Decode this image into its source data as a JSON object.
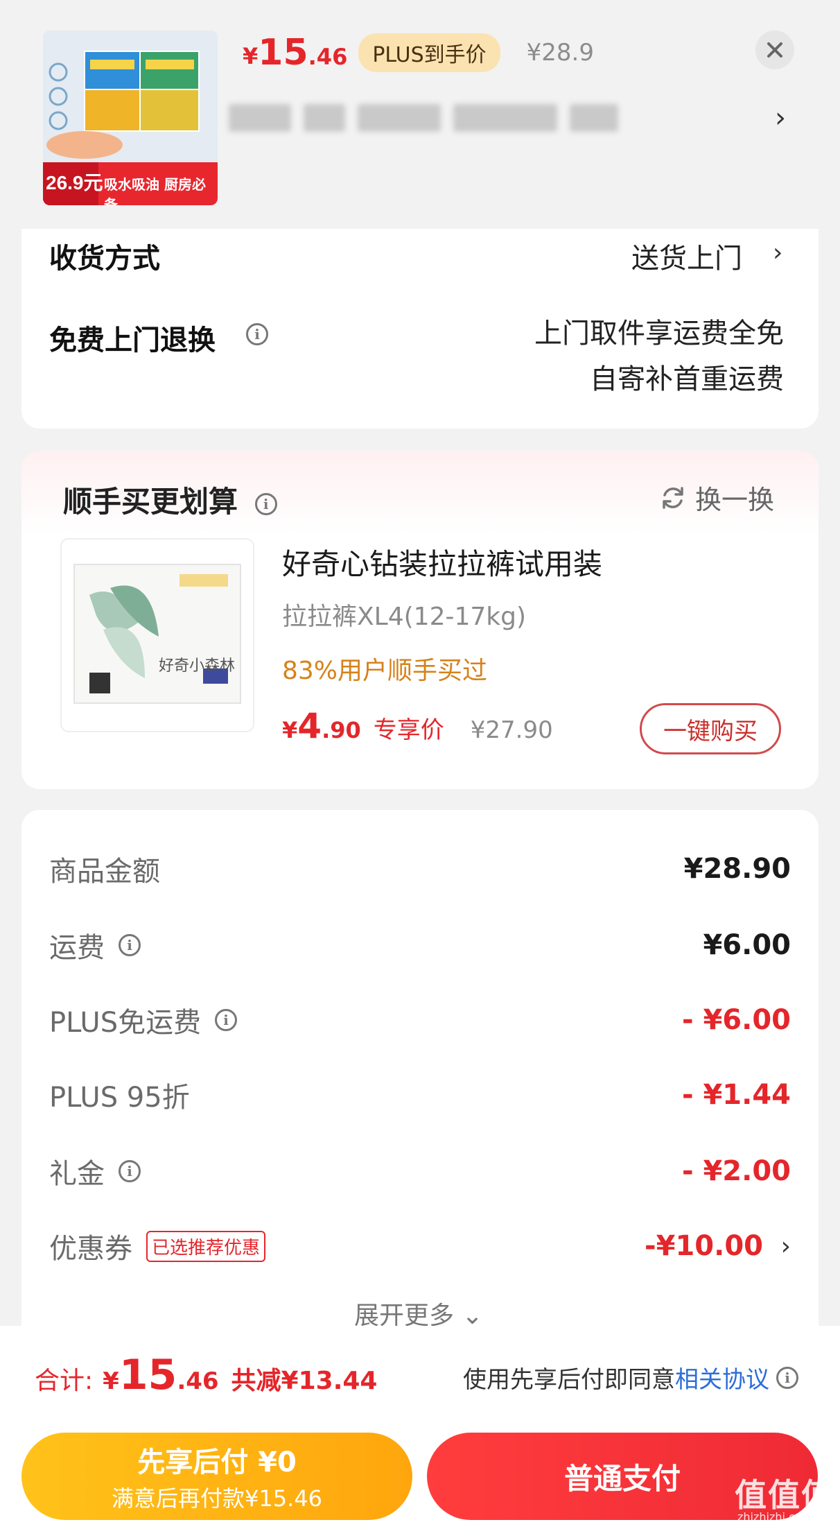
{
  "header": {
    "price_symbol": "¥",
    "price_int": "15",
    "price_dec": ".46",
    "plus_badge": "PLUS到手价",
    "orig_price": "¥28.9",
    "thumb_promo_price": "26.9元",
    "thumb_promo_text": "吸水吸油 厨房必备"
  },
  "shipping": {
    "method_label": "收货方式",
    "method_value": "送货上门",
    "return_label": "免费上门退换",
    "return_line1": "上门取件享运费全免",
    "return_line2": "自寄补首重运费"
  },
  "bundle": {
    "title": "顺手买更划算",
    "swap_label": "换一换",
    "product_name": "好奇心钻装拉拉裤试用装",
    "product_spec": "拉拉裤XL4(12-17kg)",
    "product_social": "83%用户顺手买过",
    "price_symbol": "¥",
    "price_int": "4",
    "price_dec": ".90",
    "price_tag": "专享价",
    "orig_price": "¥27.90",
    "buy_button": "一键购买",
    "image_brand_text": "好奇小森林"
  },
  "summary": {
    "rows": [
      {
        "label": "商品金额",
        "value": "¥28.90"
      },
      {
        "label": "运费",
        "value": "¥6.00"
      },
      {
        "label": "PLUS免运费",
        "value": "- ¥6.00"
      },
      {
        "label": "PLUS 95折",
        "value": "- ¥1.44"
      },
      {
        "label": "礼金",
        "value": "- ¥2.00"
      },
      {
        "label": "优惠券",
        "value": "-¥10.00"
      }
    ],
    "coupon_tag": "已选推荐优惠",
    "expand_label": "展开更多"
  },
  "bottom": {
    "total_label": "合计:",
    "total_symbol": "¥",
    "total_int": "15",
    "total_dec": ".46",
    "total_saved": "共减¥13.44",
    "agree_text": "使用先享后付即同意",
    "agree_link": "相关协议",
    "bnpl_line1": "先享后付 ¥0",
    "bnpl_line2": "满意后再付款¥15.46",
    "pay_button": "普通支付",
    "watermark": "值值值",
    "watermark_sub": "zhizhizhi.com"
  },
  "colors": {
    "accent_red": "#e4262b",
    "plus_gold": "#fbe3b1",
    "bnpl_yellow": "#ffb414",
    "link_blue": "#2d6ed9"
  }
}
